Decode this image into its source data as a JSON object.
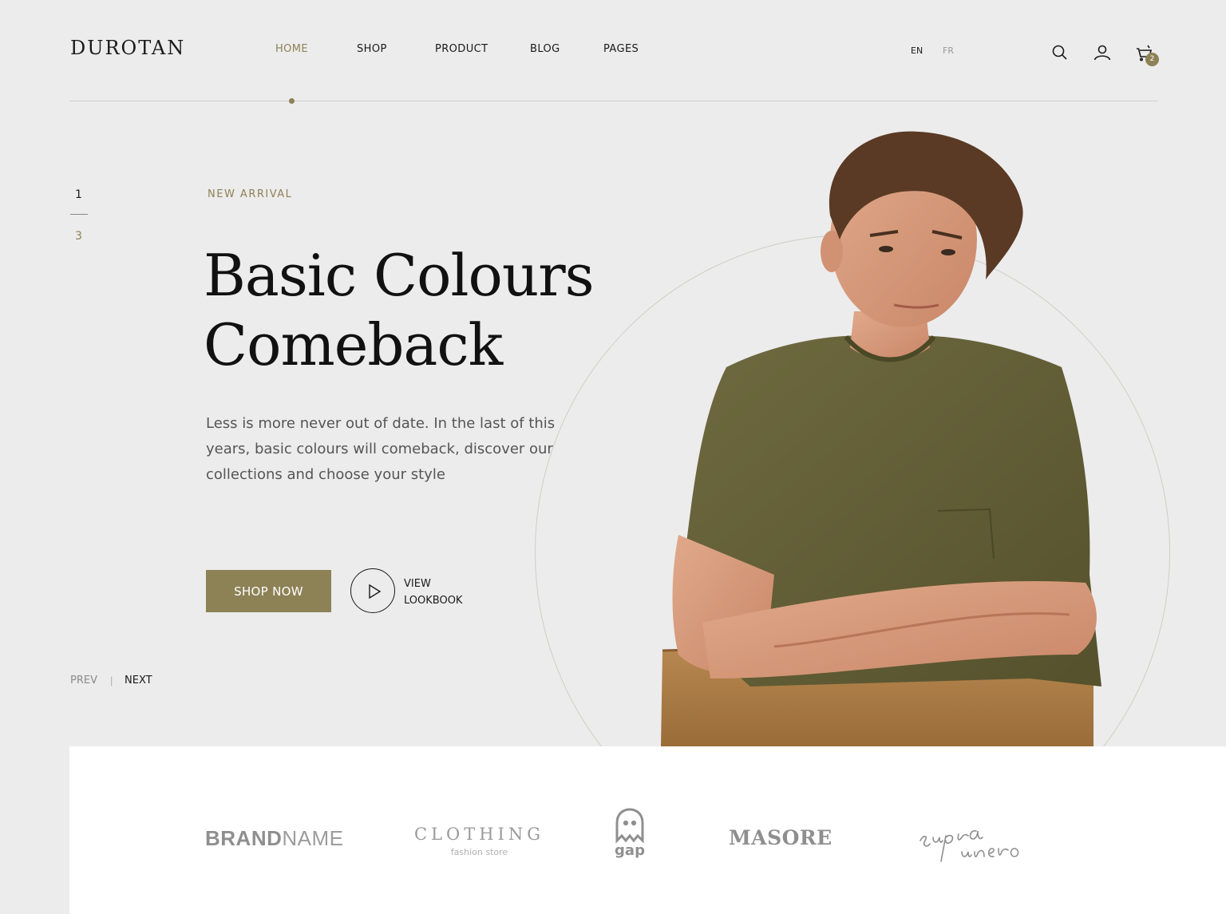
{
  "brand": {
    "name": "DUROTAN"
  },
  "nav": {
    "items": [
      {
        "label": "HOME",
        "active": true
      },
      {
        "label": "SHOP",
        "active": false
      },
      {
        "label": "PRODUCT",
        "active": false
      },
      {
        "label": "BLOG",
        "active": false
      },
      {
        "label": "PAGES",
        "active": false
      }
    ]
  },
  "languages": {
    "current": "EN",
    "other": "FR"
  },
  "header_icons": [
    "search-icon",
    "user-icon",
    "cart-icon"
  ],
  "cart": {
    "count": "2"
  },
  "slider": {
    "current": "1",
    "total": "3",
    "prev_label": "PREV",
    "separator": "|",
    "next_label": "NEXT"
  },
  "hero": {
    "eyebrow": "NEW ARRIVAL",
    "title_line1": "Basic Colours",
    "title_line2": "Comeback",
    "description": "Less is more never out of date. In the last of this years, basic colours will comeback, discover our collections and choose your style",
    "cta_label": "SHOP NOW",
    "lookbook_line1": "VIEW",
    "lookbook_line2": "LOOKBOOK"
  },
  "brands": {
    "brandname_bold": "BRAND",
    "brandname_light": "NAME",
    "clothing_main": "CLOTHING",
    "clothing_sub": "fashion store",
    "gap": "gap",
    "masore": "MASORE",
    "supra": "supra unero"
  },
  "colors": {
    "accent": "#8d8156",
    "background": "#ececec",
    "text": "#1a1a1a",
    "muted": "#8a8a8a"
  }
}
